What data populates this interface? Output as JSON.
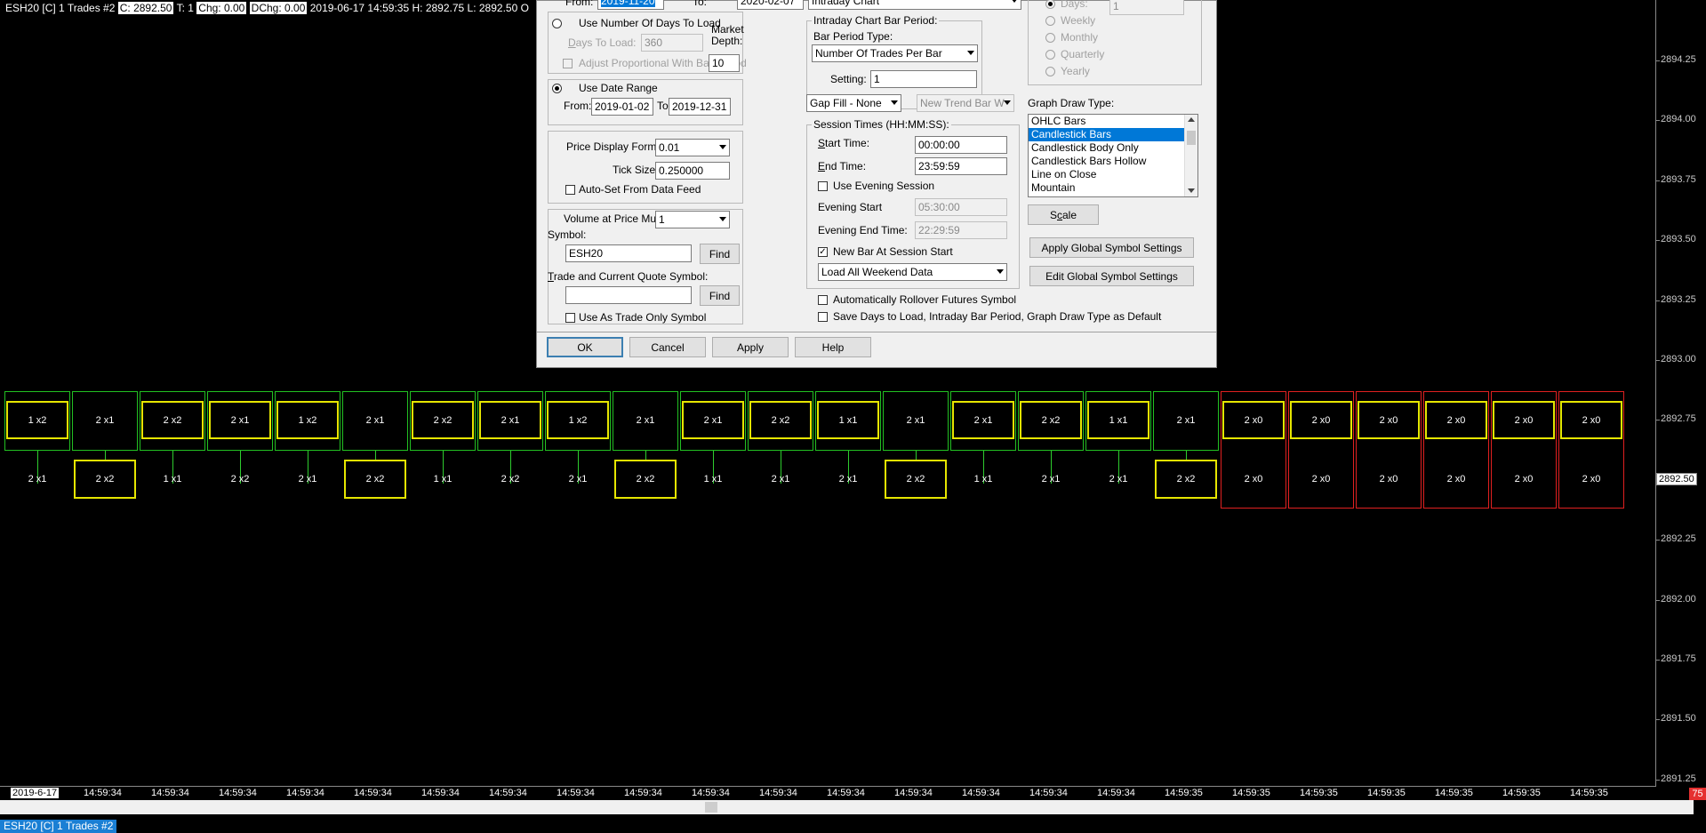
{
  "chart": {
    "header": {
      "symbol_info": "ESH20 [C]  1 Trades  #2",
      "close": "C: 2892.50",
      "trades": "T: 1",
      "chg": "Chg: 0.00",
      "dchg": "DChg: 0.00",
      "tail": "2019-06-17  14:59:35 H: 2892.75  L: 2892.50  O"
    },
    "price_scale": [
      "2894.25",
      "2894.00",
      "2893.75",
      "2893.50",
      "2893.25",
      "2893.00",
      "2892.75",
      "2892.50",
      "2892.25",
      "2892.00",
      "2891.75",
      "2891.50",
      "2891.25"
    ],
    "current_price": "2892.50",
    "date_label": "2019-6-17",
    "time_labels": [
      "14:59:34",
      "14:59:34",
      "14:59:34",
      "14:59:34",
      "14:59:34",
      "14:59:34",
      "14:59:34",
      "14:59:34",
      "14:59:34",
      "14:59:34",
      "14:59:34",
      "14:59:34",
      "14:59:34",
      "14:59:34",
      "14:59:34",
      "14:59:34",
      "14:59:34",
      "14:59:35",
      "14:59:35",
      "14:59:35",
      "14:59:35",
      "14:59:35",
      "14:59:35",
      "14:59:35"
    ],
    "bars": [
      {
        "top": "1 x2",
        "bottom": "2 x1",
        "up": true,
        "close_box": "top"
      },
      {
        "top": "2 x1",
        "bottom": "2 x2",
        "up": true,
        "close_box": "bottom"
      },
      {
        "top": "2 x2",
        "bottom": "1 x1",
        "up": true,
        "close_box": "top"
      },
      {
        "top": "2 x1",
        "bottom": "2 x2",
        "up": true,
        "close_box": "top"
      },
      {
        "top": "1 x2",
        "bottom": "2 x1",
        "up": true,
        "close_box": "top"
      },
      {
        "top": "2 x1",
        "bottom": "2 x2",
        "up": true,
        "close_box": "bottom"
      },
      {
        "top": "2 x2",
        "bottom": "1 x1",
        "up": true,
        "close_box": "top"
      },
      {
        "top": "2 x1",
        "bottom": "2 x2",
        "up": true,
        "close_box": "top"
      },
      {
        "top": "1 x2",
        "bottom": "2 x1",
        "up": true,
        "close_box": "top"
      },
      {
        "top": "2 x1",
        "bottom": "2 x2",
        "up": true,
        "close_box": "bottom"
      },
      {
        "top": "2 x1",
        "bottom": "1 x1",
        "up": true,
        "close_box": "top"
      },
      {
        "top": "2 x2",
        "bottom": "2 x1",
        "up": true,
        "close_box": "top"
      },
      {
        "top": "1 x1",
        "bottom": "2 x1",
        "up": true,
        "close_box": "top"
      },
      {
        "top": "2 x1",
        "bottom": "2 x2",
        "up": true,
        "close_box": "bottom"
      },
      {
        "top": "2 x1",
        "bottom": "1 x1",
        "up": true,
        "close_box": "top"
      },
      {
        "top": "2 x2",
        "bottom": "2 x1",
        "up": true,
        "close_box": "top"
      },
      {
        "top": "1 x1",
        "bottom": "2 x1",
        "up": true,
        "close_box": "top"
      },
      {
        "top": "2 x1",
        "bottom": "2 x2",
        "up": true,
        "close_box": "bottom"
      },
      {
        "top": "2 x0",
        "bottom": "2 x0",
        "up": false,
        "close_box": "top"
      },
      {
        "top": "2 x0",
        "bottom": "2 x0",
        "up": false,
        "close_box": "top"
      },
      {
        "top": "2 x0",
        "bottom": "2 x0",
        "up": false,
        "close_box": "top"
      },
      {
        "top": "2 x0",
        "bottom": "2 x0",
        "up": false,
        "close_box": "top"
      },
      {
        "top": "2 x0",
        "bottom": "2 x0",
        "up": false,
        "close_box": "top"
      },
      {
        "top": "2 x0",
        "bottom": "2 x0",
        "up": false,
        "close_box": "top"
      }
    ],
    "corner_badge": "75",
    "bottom_tab": "ESH20 [C]  1 Trades  #2",
    "colors": {
      "up": "#22c022",
      "down": "#e02020",
      "highlight": "#e6e600",
      "wick": "#2ecc2e"
    }
  },
  "dialog": {
    "top_from_label": "From:",
    "top_from_value": "2019-11-20",
    "top_to_label": "To:",
    "top_to_value": "2020-02-07",
    "top_chart_type": "Intraday Chart",
    "use_num_days": "Use Number Of Days To Load",
    "days_to_load_label": "Days To Load:",
    "days_to_load_value": "360",
    "adjust_proportional": "Adjust Proportional With Bar Period",
    "market_depth_label": "Market\nDepth:",
    "market_depth_value": "10",
    "use_date_range": "Use Date Range",
    "from_label": "From:",
    "from_value": "2019-01-02",
    "to_label": "To:",
    "to_value": "2019-12-31",
    "price_display_label": "Price Display Format:",
    "price_display_value": "0.01",
    "tick_size_label": "Tick Size:",
    "tick_size_value": "0.250000",
    "auto_set": "Auto-Set From Data Feed",
    "vap_mult_label": "Volume at Price Mult.:",
    "vap_mult_value": "1",
    "symbol_label": "Symbol:",
    "symbol_value": "ESH20",
    "find": "Find",
    "trade_quote_label": "Trade and Current Quote Symbol:",
    "trade_quote_value": "",
    "use_as_trade_only": "Use As Trade Only Symbol",
    "intraday_group": "Intraday Chart Bar Period:",
    "bar_period_type_label": "Bar Period Type:",
    "bar_period_type_value": "Number Of Trades Per Bar",
    "setting_label": "Setting:",
    "setting_value": "1",
    "gap_fill_value": "Gap Fill - None",
    "new_trend_value": "New Trend Bar W",
    "session_group": "Session Times (HH:MM:SS):",
    "start_time_label": "Start Time:",
    "start_time_value": "00:00:00",
    "end_time_label": "End Time:",
    "end_time_value": "23:59:59",
    "use_evening": "Use Evening Session",
    "evening_start_label": "Evening Start",
    "evening_start_value": "05:30:00",
    "evening_end_label": "Evening End Time:",
    "evening_end_value": "22:29:59",
    "new_bar_session": "New Bar At Session Start",
    "weekend_value": "Load All Weekend Data",
    "auto_rollover": "Automatically Rollover Futures Symbol",
    "save_defaults": "Save Days to Load, Intraday Bar Period, Graph Draw Type as Default",
    "period_radios": [
      "Days:",
      "Weekly",
      "Monthly",
      "Quarterly",
      "Yearly"
    ],
    "days_value": "1",
    "graph_draw_label": "Graph Draw Type:",
    "graph_draw_items": [
      "OHLC Bars",
      "Candlestick Bars",
      "Candlestick Body Only",
      "Candlestick Bars Hollow",
      "Line on Close",
      "Mountain"
    ],
    "graph_draw_selected": 1,
    "scale_btn": "Scale",
    "apply_global": "Apply Global Symbol Settings",
    "edit_global": "Edit Global Symbol Settings",
    "ok": "OK",
    "cancel": "Cancel",
    "apply": "Apply",
    "help": "Help"
  }
}
